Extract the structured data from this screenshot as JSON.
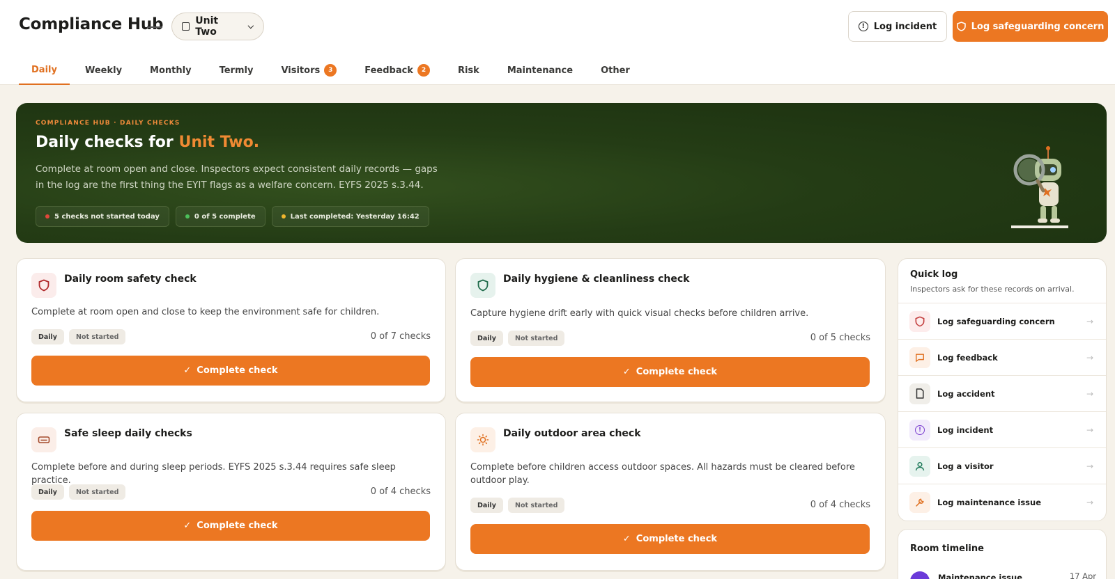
{
  "header": {
    "brand": "Compliance Hub",
    "unit": "Unit Two",
    "incident_button": "Log incident",
    "safeguarding_button": "Log safeguarding concern"
  },
  "tabs": [
    {
      "label": "Daily",
      "active": true
    },
    {
      "label": "Weekly"
    },
    {
      "label": "Monthly"
    },
    {
      "label": "Termly"
    },
    {
      "label": "Visitors",
      "count": "3"
    },
    {
      "label": "Feedback",
      "count": "2"
    },
    {
      "label": "Risk"
    },
    {
      "label": "Maintenance"
    },
    {
      "label": "Other"
    }
  ],
  "hero": {
    "kicker": "COMPLIANCE HUB · DAILY CHECKS",
    "title_prefix": "Daily checks for",
    "title_accent": "Unit Two.",
    "description": "Complete at room open and close. Inspectors expect consistent daily records — gaps in the log are the first thing the EYIT flags as a welfare concern. EYFS 2025 s.3.44.",
    "chips": [
      {
        "label": "5 checks not started today",
        "color": "#e0473a"
      },
      {
        "label": "0 of 5 complete",
        "color": "#4cbf5a"
      },
      {
        "label": "Last completed: Yesterday 16:42",
        "color": "#f0b62e"
      }
    ]
  },
  "cards": [
    {
      "title": "Daily room safety check",
      "description": "Complete at room open and close to keep the environment safe for children.",
      "frequency": "Daily",
      "status": "Not started",
      "progress": "0 of 7 checks",
      "button": "Complete check",
      "icon": "shield-icon",
      "accent": "#b0282a"
    },
    {
      "title": "Daily hygiene & cleanliness check",
      "description": "Capture hygiene drift early with quick visual checks before children arrive.",
      "frequency": "Daily",
      "status": "Not started",
      "progress": "0 of 5 checks",
      "button": "Complete check",
      "icon": "shield-icon",
      "accent": "#1f6b4a"
    },
    {
      "title": "Safe sleep daily checks",
      "description": "Complete before and during sleep periods. EYFS 2025 s.3.44 requires safe sleep practice.",
      "frequency": "Daily",
      "status": "Not started",
      "progress": "0 of 4 checks",
      "button": "Complete check",
      "icon": "bed-icon",
      "accent": "#a44a2b"
    },
    {
      "title": "Daily outdoor area check",
      "description": "Complete before children access outdoor spaces. All hazards must be cleared before outdoor play.",
      "frequency": "Daily",
      "status": "Not started",
      "progress": "0 of 4 checks",
      "button": "Complete check",
      "icon": "sun-icon",
      "accent": "#e07020"
    }
  ],
  "quick_log": {
    "title": "Quick log",
    "subtitle": "Inspectors ask for these records on arrival.",
    "items": [
      {
        "label": "Log safeguarding concern",
        "icon": "shield-icon",
        "color": "#c23a3a",
        "bg": "#fdecec"
      },
      {
        "label": "Log feedback",
        "icon": "chat-icon",
        "color": "#e07020",
        "bg": "#fdf0e6"
      },
      {
        "label": "Log accident",
        "icon": "document-icon",
        "color": "#333333",
        "bg": "#f0eee9"
      },
      {
        "label": "Log incident",
        "icon": "alert-icon",
        "color": "#7b3fd0",
        "bg": "#f1eafb"
      },
      {
        "label": "Log a visitor",
        "icon": "person-icon",
        "color": "#1f7a5a",
        "bg": "#e6f3ee"
      },
      {
        "label": "Log maintenance issue",
        "icon": "wrench-icon",
        "color": "#e07020",
        "bg": "#fdf0e6"
      }
    ]
  },
  "timeline": {
    "title": "Room timeline",
    "item": "Maintenance issue",
    "date": "17 Apr"
  }
}
